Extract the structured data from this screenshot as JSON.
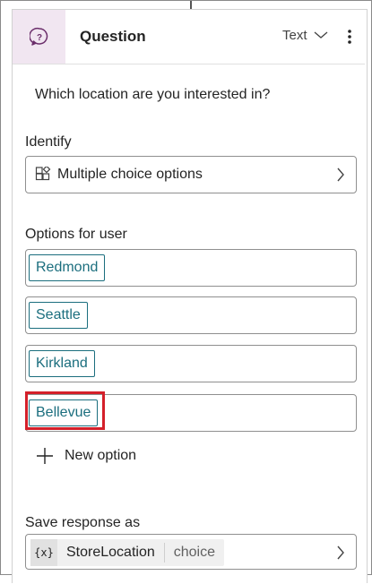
{
  "header": {
    "title": "Question",
    "response_type": "Text",
    "icon": "question-bubble-icon",
    "accent_color": "#f1e6f1"
  },
  "question": {
    "text": "Which location are you interested in?"
  },
  "identify": {
    "label": "Identify",
    "value": "Multiple choice options",
    "icon": "entity-icon"
  },
  "options": {
    "label": "Options for user",
    "items": [
      {
        "label": "Redmond"
      },
      {
        "label": "Seattle"
      },
      {
        "label": "Kirkland"
      },
      {
        "label": "Bellevue"
      }
    ],
    "chip_color": "#1b6e7e",
    "highlight_color": "#d4202a",
    "new_option_label": "New option"
  },
  "save_response": {
    "label": "Save response as",
    "variable_icon_text": "{x}",
    "variable_name": "StoreLocation",
    "variable_type": "choice"
  }
}
